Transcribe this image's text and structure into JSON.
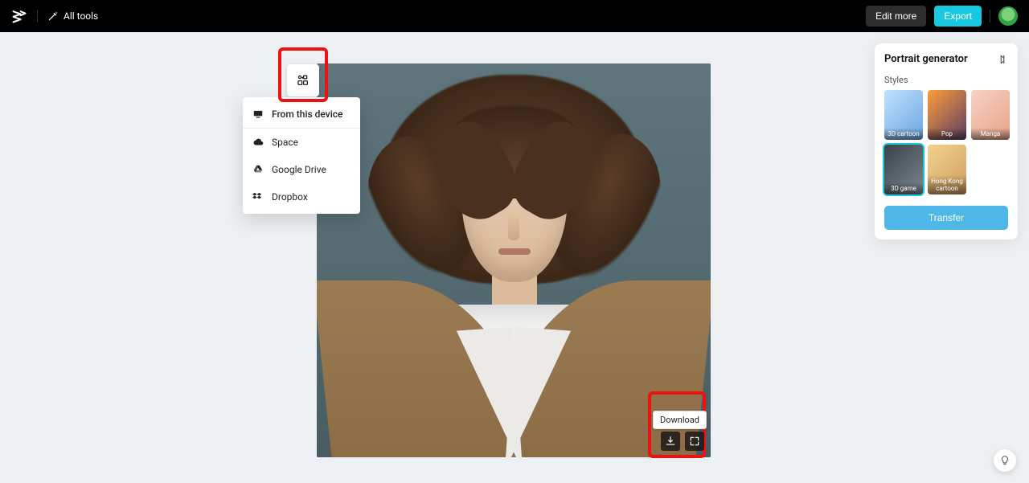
{
  "header": {
    "all_tools_label": "All tools",
    "edit_more_label": "Edit more",
    "export_label": "Export"
  },
  "upload_menu": {
    "from_device": "From this device",
    "space": "Space",
    "google_drive": "Google Drive",
    "dropbox": "Dropbox"
  },
  "download_tooltip": "Download",
  "panel": {
    "title": "Portrait generator",
    "section_label": "Styles",
    "styles": [
      {
        "label": "3D cartoon"
      },
      {
        "label": "Pop"
      },
      {
        "label": "Manga"
      },
      {
        "label": "3D game"
      },
      {
        "label": "Hong Kong cartoon"
      }
    ],
    "selected_style_index": 3,
    "transfer_label": "Transfer"
  }
}
